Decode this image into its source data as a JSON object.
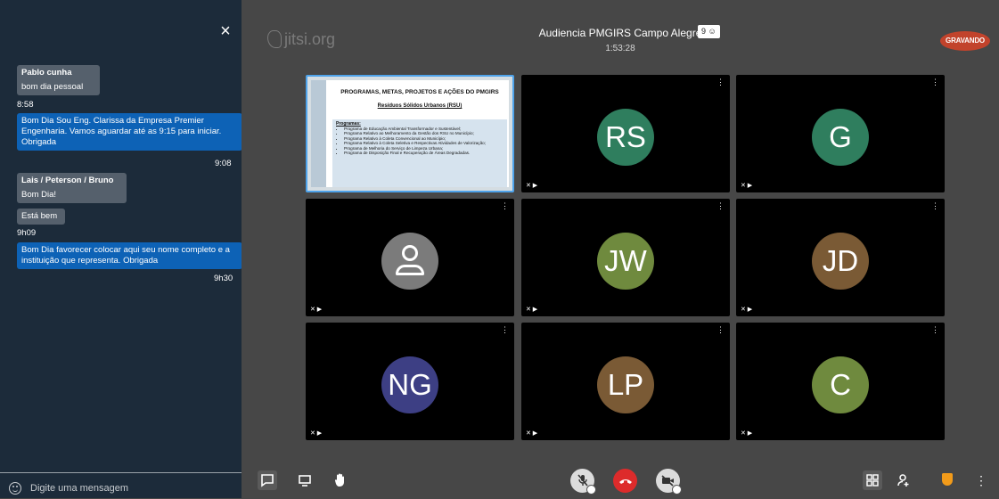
{
  "chat": {
    "close_label": "×",
    "input_placeholder": "Digite uma mensagem",
    "messages": [
      {
        "sender": "Pablo cunha",
        "text": "bom dia pessoal",
        "time": "8:58"
      },
      {
        "text": "Bom Dia Sou Eng. Clarissa da Empresa Premier Engenharia. Vamos aguardar até as 9:15 para iniciar. Obrigada",
        "time": "9:08"
      },
      {
        "sender": "Lais / Peterson / Bruno",
        "text": "Bom Dia!"
      },
      {
        "text": "Está bem",
        "time": "9h09"
      },
      {
        "text": "Bom Dia favorecer colocar aqui seu nome completo e a instituição que representa. Obrigada",
        "time": "9h30"
      }
    ]
  },
  "header": {
    "logo_text": "jitsi.org",
    "meeting_title": "Audiencia PMGIRS Campo Alegre",
    "participant_count": "9",
    "timer": "1:53:28",
    "recording_label": "GRAVANDO"
  },
  "slide": {
    "title": "PROGRAMAS, METAS, PROJETOS E AÇÕES DO PMGIRS",
    "subtitle": "Resíduos Sólidos Urbanos (RSU)",
    "heading": "Programas:",
    "items": [
      "Programa de Educação Ambiental Transformador e Sustentável;",
      "Programa Relativo ao Melhoramento da Gestão dos RSU no Município;",
      "Programa Relativo à Coleta Convencional ao Município;",
      "Programa Relativo à Coleta Seletiva e Respectivas Atividades de Valorização;",
      "Programa de Melhoria do Serviço de Limpeza Urbana;",
      "Programa de Disposição Final e Recuperação de Áreas Degradadas."
    ]
  },
  "tiles": [
    {
      "initials": "RS",
      "color": "#2f7e5e"
    },
    {
      "initials": "G",
      "color": "#2f7e5e"
    },
    {
      "initials": "",
      "color": "#7b7b7b"
    },
    {
      "initials": "JW",
      "color": "#6f8a3e"
    },
    {
      "initials": "JD",
      "color": "#7a5a35"
    },
    {
      "initials": "NG",
      "color": "#3d3f84"
    },
    {
      "initials": "LP",
      "color": "#7a5a35"
    },
    {
      "initials": "C",
      "color": "#6f8a3e"
    }
  ],
  "icons": {
    "tile_menu": "⋮",
    "status": "✕ ▶"
  }
}
